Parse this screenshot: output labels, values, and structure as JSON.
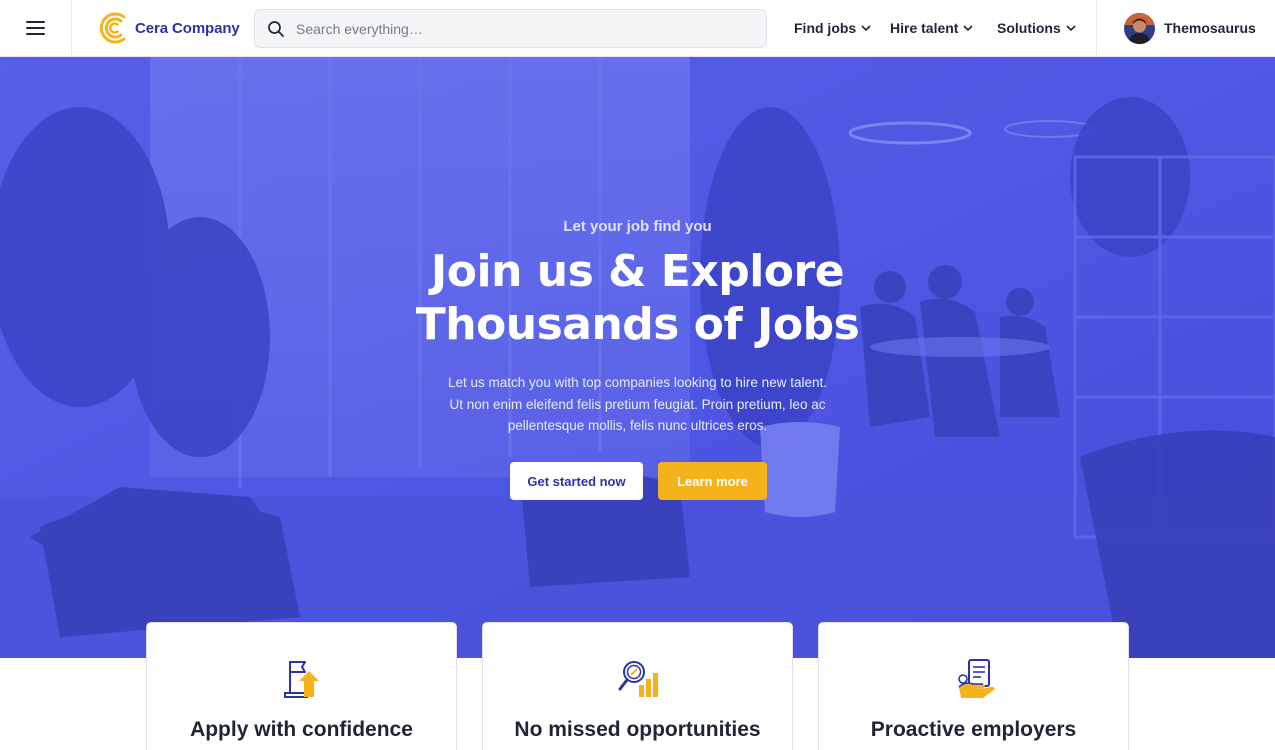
{
  "nav": {
    "menu_icon": "hamburger-menu-icon",
    "brand": {
      "name": "Cera Company",
      "logo": "cera-c-logo"
    },
    "search": {
      "placeholder": "Search everything…",
      "icon": "search-icon"
    },
    "items": [
      {
        "label": "Find jobs",
        "icon": "chevron-down-icon"
      },
      {
        "label": "Hire talent",
        "icon": "chevron-down-icon"
      },
      {
        "label": "Solutions",
        "icon": "chevron-down-icon"
      }
    ],
    "user": {
      "name": "Themosaurus",
      "avatar": "avatar"
    }
  },
  "hero": {
    "eyebrow": "Let your job find you",
    "headline_line1": "Join us & Explore",
    "headline_line2": "Thousands of Jobs",
    "lead_line1": "Let us match you with top companies looking to hire new talent.",
    "lead_line2": "Ut non enim eleifend felis pretium feugiat. Proin pretium, leo ac",
    "lead_line3": "pellentesque mollis, felis nunc ultrices eros.",
    "primary_cta": "Get started now",
    "secondary_cta": "Learn more"
  },
  "features": [
    {
      "title": "Apply with confidence",
      "icon": "flag-arrow-icon"
    },
    {
      "title": "No missed opportunities",
      "icon": "magnifier-chart-icon"
    },
    {
      "title": "Proactive employers",
      "icon": "clipboard-hand-icon"
    }
  ],
  "colors": {
    "brand": "#2a33a8",
    "accent": "#f5b21b",
    "hero_overlay": "#4c55e0"
  }
}
